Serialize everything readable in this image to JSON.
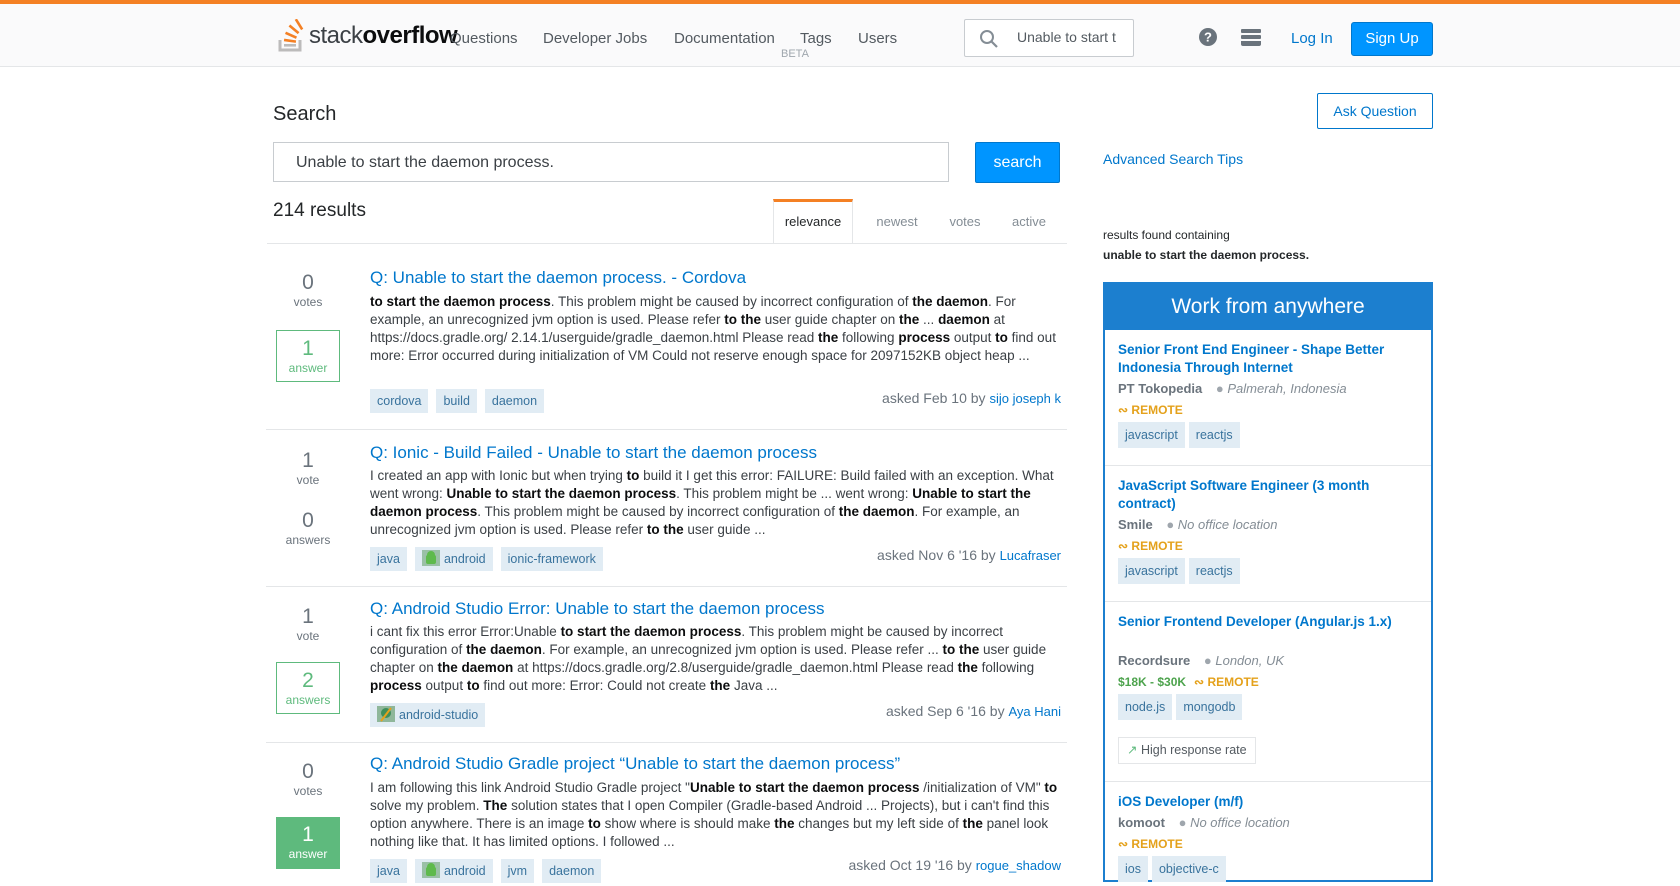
{
  "header": {
    "logo_light": "stack",
    "logo_bold": "overflow",
    "nav": [
      "Questions",
      "Developer Jobs",
      "Documentation",
      "Tags",
      "Users"
    ],
    "documentation_badge": "BETA",
    "search_value": "Unable to start t",
    "login_label": "Log In",
    "signup_label": "Sign Up",
    "icons": [
      "search-icon",
      "help-icon",
      "achievements-inbox-icon"
    ]
  },
  "search_page": {
    "heading": "Search",
    "query": "Unable to start the daemon process.",
    "search_button": "search",
    "ask_button": "Ask Question",
    "advanced_tips": "Advanced Search Tips",
    "results_count": "214 results",
    "tabs": [
      "relevance",
      "newest",
      "votes",
      "active"
    ],
    "active_tab": "relevance",
    "found_containing_label": "results found containing",
    "found_containing_query": "unable to start the daemon process."
  },
  "results": [
    {
      "votes": "0",
      "votes_label": "votes",
      "answers": "1",
      "answers_label": "answer",
      "answer_style": "green",
      "title": "Q: Unable to start the daemon process. - Cordova",
      "excerpt_html": "<b>to start the daemon process</b>. This problem might be caused by incorrect configuration of <b>the daemon</b>. For example, an unrecognized jvm option is used. Please refer <b>to the</b> user guide chapter on <b>the</b> ... <b>daemon</b> at https://docs.gradle.org/ 2.14.1/userguide/gradle_daemon.html Please read <b>the</b> following <b>process</b> output <b>to</b> find out more: Error occurred during initialization of VM Could not reserve enough space for 2097152KB object heap ...",
      "tags": [
        "cordova",
        "build",
        "daemon"
      ],
      "asked": "asked Feb 10 by",
      "user": "sijo joseph k"
    },
    {
      "votes": "1",
      "votes_label": "vote",
      "answers": "0",
      "answers_label": "answers",
      "answer_style": "plain",
      "title": "Q: Ionic - Build Failed - Unable to start the daemon process",
      "excerpt_html": "I created an app with Ionic but when trying <b>to</b> build it I get this error: FAILURE: Build failed with an exception. What went wrong: <b>Unable to start the daemon process</b>. This problem might be ... went wrong: <b>Unable to start the daemon process</b>. This problem might be caused by incorrect configuration of <b>the daemon</b>. For example, an unrecognized jvm option is used. Please refer <b>to the</b> user guide ...",
      "tags": [
        "java",
        "android",
        "ionic-framework"
      ],
      "asked": "asked Nov 6 '16 by",
      "user": "Lucafraser"
    },
    {
      "votes": "1",
      "votes_label": "vote",
      "answers": "2",
      "answers_label": "answers",
      "answer_style": "green",
      "title": "Q: Android Studio Error: Unable to start the daemon process",
      "excerpt_html": "i cant fix this error Error:Unable <b>to start the daemon process</b>. This problem might be caused by incorrect configuration of <b>the daemon</b>. For example, an unrecognized jvm option is used. Please refer ... <b>to the</b> user guide chapter on <b>the daemon</b> at https://docs.gradle.org/2.8/userguide/gradle_daemon.html Please read <b>the</b> following <b>process</b> output <b>to</b> find out more: Error: Could not create <b>the</b> Java ...",
      "tags": [
        "android-studio"
      ],
      "asked": "asked Sep 6 '16 by",
      "user": "Aya Hani"
    },
    {
      "votes": "0",
      "votes_label": "votes",
      "answers": "1",
      "answers_label": "answer",
      "answer_style": "accepted",
      "title": "Q: Android Studio Gradle project “Unable to start the daemon process”",
      "excerpt_html": "I am following this link Android Studio Gradle project \"<b>Unable to start the daemon process</b> /initialization of VM\" <b>to</b> solve my problem. <b>The</b> solution states that I open Compiler (Gradle-based Android ... Projects), but i can't find this option anywhere. There is an image <b>to</b> show where is should make <b>the</b> changes but my left side of <b>the</b> panel look nothing like that. It has limited options. I followed ...",
      "tags": [
        "java",
        "android",
        "jvm",
        "daemon"
      ],
      "asked": "asked Oct 19 '16 by",
      "user": "rogue_shadow"
    }
  ],
  "jobs": {
    "heading": "Work from anywhere",
    "remote_label": "REMOTE",
    "items": [
      {
        "title": "Senior Front End Engineer - Shape Better Indonesia Through Internet",
        "company": "PT Tokopedia",
        "location": "Palmerah, Indonesia",
        "salary": "",
        "tags": [
          "javascript",
          "reactjs"
        ]
      },
      {
        "title": "JavaScript Software Engineer (3 month contract)",
        "company": "Smile",
        "location": "No office location",
        "salary": "",
        "tags": [
          "javascript",
          "reactjs"
        ]
      },
      {
        "title": "Senior Frontend Developer (Angular.js 1.x)",
        "company": "Recordsure",
        "location": "London, UK",
        "salary": "$18K - $30K",
        "tags": [
          "node.js",
          "mongodb"
        ],
        "badge": "High response rate"
      },
      {
        "title": "iOS Developer (m/f)",
        "company": "komoot",
        "location": "No office location",
        "salary": "",
        "tags": [
          "ios",
          "objective-c"
        ]
      }
    ]
  },
  "colors": {
    "accent": "#f48024",
    "link": "#0077cc",
    "primary_button": "#0095ff",
    "jobs_header": "#1c7fcf",
    "answered": "#5eba7d",
    "remote": "#e4a11b",
    "tag_bg": "#e1ecf4"
  }
}
